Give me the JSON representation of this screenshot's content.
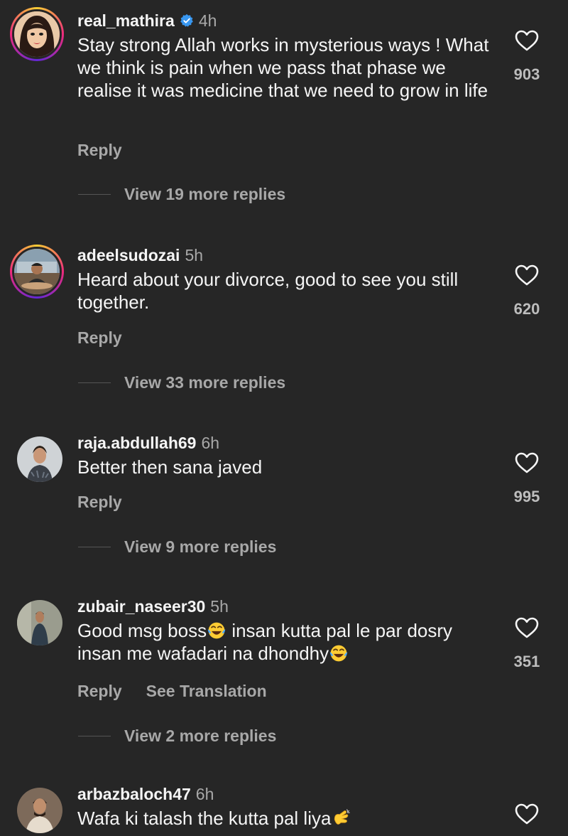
{
  "comments": [
    {
      "username": "real_mathira",
      "verified": true,
      "time": "4h",
      "text": "Stay strong Allah works in mysterious ways ! What we think is pain when we pass that phase we realise it was medicine that we need to grow in life",
      "reply_label": "Reply",
      "view_replies": "View 19 more replies",
      "likes": "903",
      "avatar_icon": "woman-avatar"
    },
    {
      "username": "adeelsudozai",
      "verified": false,
      "time": "5h",
      "text": "Heard about your divorce, good to see you still together.",
      "reply_label": "Reply",
      "view_replies": "View 33 more replies",
      "likes": "620",
      "avatar_icon": "man-avatar"
    },
    {
      "username": "raja.abdullah69",
      "verified": false,
      "time": "6h",
      "text": "Better then sana javed",
      "reply_label": "Reply",
      "view_replies": "View 9 more replies",
      "likes": "995",
      "avatar_icon": "man-avatar"
    },
    {
      "username": "zubair_naseer30",
      "verified": false,
      "time": "5h",
      "text_part1": "Good msg boss",
      "text_part2": " insan kutta pal le par dosry insan me wafadari na dhondhy",
      "reply_label": "Reply",
      "translation_label": "See Translation",
      "view_replies": "View 2 more replies",
      "likes": "351",
      "emoji_icon": "tears-of-joy-emoji"
    },
    {
      "username": "arbazbaloch47",
      "verified": false,
      "time": "6h",
      "text": "Wafa ki talash the kutta pal liya",
      "emoji_icon": "clapping-hands-emoji",
      "avatar_icon": "man-avatar"
    }
  ],
  "colors": {
    "background": "#262626",
    "primary_text": "#f5f5f5",
    "secondary_text": "#a8a8a8",
    "verified_badge": "#3897f0"
  }
}
